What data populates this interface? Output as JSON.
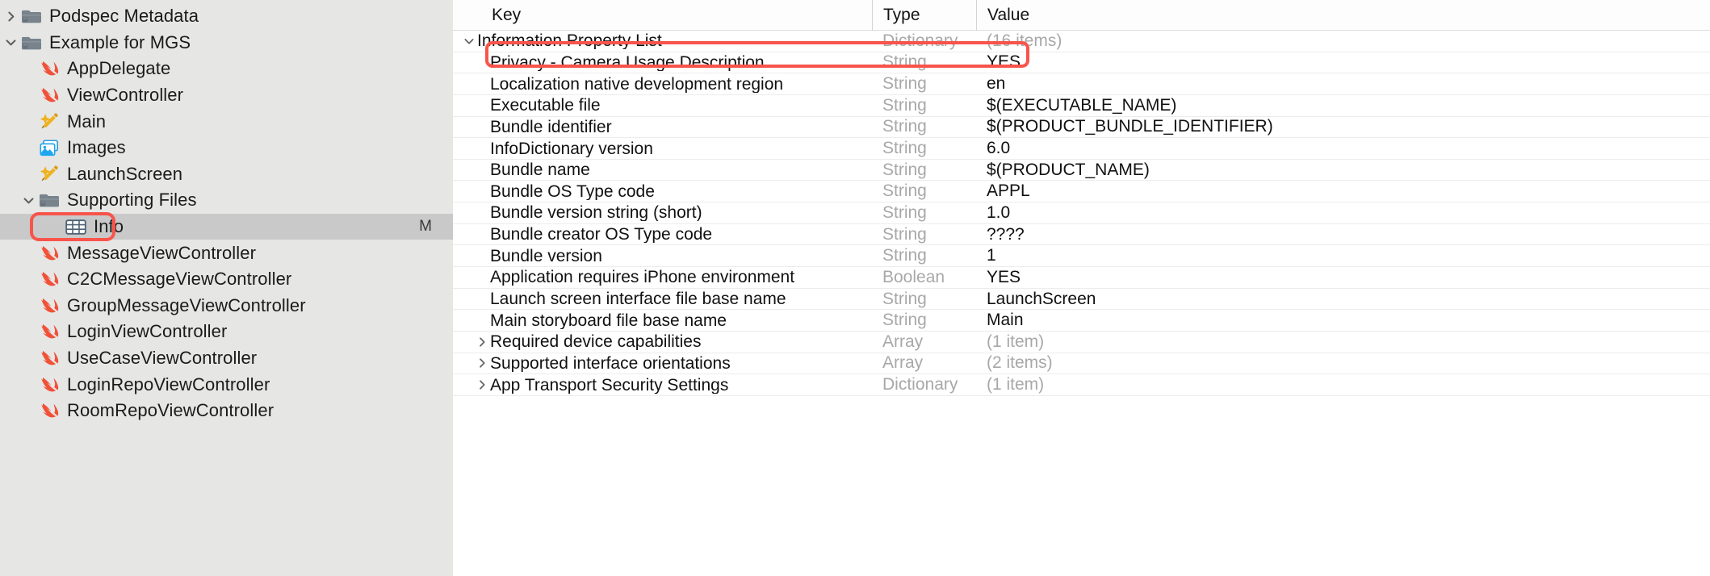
{
  "sidebar": {
    "items": [
      {
        "label": "Podspec Metadata",
        "icon": "folder-icon",
        "level": 0,
        "twisty": "right",
        "selected": false,
        "badge": ""
      },
      {
        "label": "Example for MGS",
        "icon": "folder-icon",
        "level": 0,
        "twisty": "down",
        "selected": false,
        "badge": ""
      },
      {
        "label": "AppDelegate",
        "icon": "swift-icon",
        "level": 1,
        "twisty": "none",
        "selected": false,
        "badge": ""
      },
      {
        "label": "ViewController",
        "icon": "swift-icon",
        "level": 1,
        "twisty": "none",
        "selected": false,
        "badge": ""
      },
      {
        "label": "Main",
        "icon": "storyboard-icon",
        "level": 1,
        "twisty": "none",
        "selected": false,
        "badge": ""
      },
      {
        "label": "Images",
        "icon": "assets-icon",
        "level": 1,
        "twisty": "none",
        "selected": false,
        "badge": ""
      },
      {
        "label": "LaunchScreen",
        "icon": "storyboard-icon",
        "level": 1,
        "twisty": "none",
        "selected": false,
        "badge": ""
      },
      {
        "label": "Supporting Files",
        "icon": "folder-icon",
        "level": 1,
        "twisty": "down",
        "selected": false,
        "badge": ""
      },
      {
        "label": "Info",
        "icon": "plist-icon",
        "level": 2,
        "twisty": "none",
        "selected": true,
        "badge": "M"
      },
      {
        "label": "MessageViewController",
        "icon": "swift-icon",
        "level": 1,
        "twisty": "none",
        "selected": false,
        "badge": ""
      },
      {
        "label": "C2CMessageViewController",
        "icon": "swift-icon",
        "level": 1,
        "twisty": "none",
        "selected": false,
        "badge": ""
      },
      {
        "label": "GroupMessageViewController",
        "icon": "swift-icon",
        "level": 1,
        "twisty": "none",
        "selected": false,
        "badge": ""
      },
      {
        "label": "LoginViewController",
        "icon": "swift-icon",
        "level": 1,
        "twisty": "none",
        "selected": false,
        "badge": ""
      },
      {
        "label": "UseCaseViewController",
        "icon": "swift-icon",
        "level": 1,
        "twisty": "none",
        "selected": false,
        "badge": ""
      },
      {
        "label": "LoginRepoViewController",
        "icon": "swift-icon",
        "level": 1,
        "twisty": "none",
        "selected": false,
        "badge": ""
      },
      {
        "label": "RoomRepoViewController",
        "icon": "swift-icon",
        "level": 1,
        "twisty": "none",
        "selected": false,
        "badge": ""
      }
    ]
  },
  "plist": {
    "columns": {
      "key": "Key",
      "type": "Type",
      "value": "Value"
    },
    "rows": [
      {
        "key": "Information Property List",
        "type": "Dictionary",
        "value": "(16 items)",
        "level": 0,
        "twisty": "down",
        "stepper": false,
        "value_muted": true
      },
      {
        "key": "Privacy - Camera Usage Description",
        "type": "String",
        "value": "YES",
        "level": 1,
        "twisty": "none",
        "stepper": true,
        "value_muted": false
      },
      {
        "key": "Localization native development region",
        "type": "String",
        "value": "en",
        "level": 1,
        "twisty": "none",
        "stepper": true,
        "value_muted": false
      },
      {
        "key": "Executable file",
        "type": "String",
        "value": "$(EXECUTABLE_NAME)",
        "level": 1,
        "twisty": "none",
        "stepper": true,
        "value_muted": false
      },
      {
        "key": "Bundle identifier",
        "type": "String",
        "value": "$(PRODUCT_BUNDLE_IDENTIFIER)",
        "level": 1,
        "twisty": "none",
        "stepper": true,
        "value_muted": false
      },
      {
        "key": "InfoDictionary version",
        "type": "String",
        "value": "6.0",
        "level": 1,
        "twisty": "none",
        "stepper": true,
        "value_muted": false
      },
      {
        "key": "Bundle name",
        "type": "String",
        "value": "$(PRODUCT_NAME)",
        "level": 1,
        "twisty": "none",
        "stepper": true,
        "value_muted": false
      },
      {
        "key": "Bundle OS Type code",
        "type": "String",
        "value": "APPL",
        "level": 1,
        "twisty": "none",
        "stepper": true,
        "value_muted": false
      },
      {
        "key": "Bundle version string (short)",
        "type": "String",
        "value": "1.0",
        "level": 1,
        "twisty": "none",
        "stepper": true,
        "value_muted": false
      },
      {
        "key": "Bundle creator OS Type code",
        "type": "String",
        "value": "????",
        "level": 1,
        "twisty": "none",
        "stepper": true,
        "value_muted": false
      },
      {
        "key": "Bundle version",
        "type": "String",
        "value": "1",
        "level": 1,
        "twisty": "none",
        "stepper": true,
        "value_muted": false
      },
      {
        "key": "Application requires iPhone environment",
        "type": "Boolean",
        "value": "YES",
        "level": 1,
        "twisty": "none",
        "stepper": true,
        "value_muted": false
      },
      {
        "key": "Launch screen interface file base name",
        "type": "String",
        "value": "LaunchScreen",
        "level": 1,
        "twisty": "none",
        "stepper": true,
        "value_muted": false
      },
      {
        "key": "Main storyboard file base name",
        "type": "String",
        "value": "Main",
        "level": 1,
        "twisty": "none",
        "stepper": true,
        "value_muted": false
      },
      {
        "key": "Required device capabilities",
        "type": "Array",
        "value": "(1 item)",
        "level": 1,
        "twisty": "right",
        "stepper": true,
        "value_muted": true
      },
      {
        "key": "Supported interface orientations",
        "type": "Array",
        "value": "(2 items)",
        "level": 1,
        "twisty": "right",
        "stepper": true,
        "value_muted": true
      },
      {
        "key": "App Transport Security Settings",
        "type": "Dictionary",
        "value": "(1 item)",
        "level": 1,
        "twisty": "right",
        "stepper": true,
        "value_muted": true
      }
    ]
  },
  "annotations": {
    "highlight_color": "#f8544b",
    "highlighted_sidebar_item": "Info",
    "highlighted_row_key": "Privacy - Camera Usage Description"
  }
}
